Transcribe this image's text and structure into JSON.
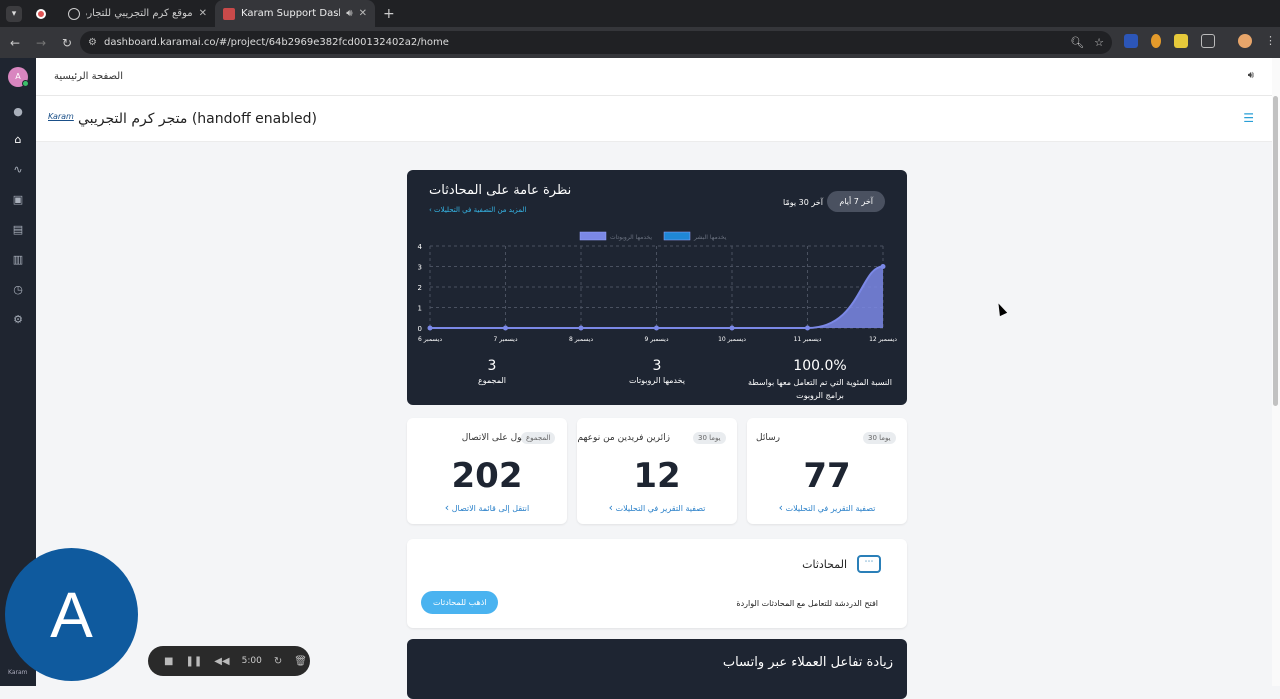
{
  "browser": {
    "tabs": [
      {
        "title": "موقع كرم التجريبي للتجارة الإلـ",
        "active": false
      },
      {
        "title": "Karam Support Dashb",
        "active": true
      }
    ],
    "url": "dashboard.karamai.co/#/project/64b2969e382fcd00132402a2/home"
  },
  "topbar": {
    "breadcrumb": "الصفحة الرئيسية"
  },
  "header": {
    "logo_text": "Karam",
    "project_title": "متجر كرم التجريبي (handoff enabled)"
  },
  "overview": {
    "title": "نظرة عامة على المحادثات",
    "link": "المزيد من التصفية في التحليلات",
    "range_active": "آخر 7 أيام",
    "range_other": "آخر 30 يومًا",
    "stats": [
      {
        "value": "100.0%",
        "label": "النسبة المئوية التي تم التعامل معها بواسطة برامج الروبوت"
      },
      {
        "value": "3",
        "label": "يخدمها الروبوتات"
      },
      {
        "value": "3",
        "label": "المجموع"
      }
    ]
  },
  "chart_data": {
    "type": "area",
    "categories": [
      "ديسمبر 6",
      "ديسمبر 7",
      "ديسمبر 8",
      "ديسمبر 9",
      "ديسمبر 10",
      "ديسمبر 11",
      "ديسمبر 12"
    ],
    "series": [
      {
        "name": "يخدمها الروبوتات",
        "values": [
          0,
          0,
          0,
          0,
          0,
          0,
          3
        ],
        "color": "#7b88e6"
      },
      {
        "name": "يخدمها البشر",
        "values": [
          0,
          0,
          0,
          0,
          0,
          0,
          0
        ],
        "color": "#1f87d6"
      }
    ],
    "ylim": [
      0,
      4
    ],
    "yticks": [
      "0",
      "1",
      "2",
      "3",
      "4"
    ],
    "grid": true,
    "legend": "top-center"
  },
  "cards": [
    {
      "label": "رسائل",
      "pill": "30 يوما",
      "value": "77",
      "link": "تصفية التقرير في التحليلات"
    },
    {
      "label": "زائرين فريدين من نوعهم",
      "pill": "30 يوما",
      "value": "12",
      "link": "تصفية التقرير في التحليلات"
    },
    {
      "label": "تم الحصول على الاتصال",
      "pill": "المجموع",
      "value": "202",
      "link": "انتقل إلى قائمة الاتصال"
    }
  ],
  "conversations": {
    "title": "المحادثات",
    "desc": "افتح الدردشة للتعامل مع المحادثات الواردة",
    "button": "اذهب للمحادثات"
  },
  "whatsapp": {
    "title": "زيادة تفاعل العملاء عبر واتساب"
  },
  "avatar": {
    "letter": "A",
    "small": "A"
  },
  "recorder": {
    "time": "5:00"
  },
  "sidebar_footer": "Karam"
}
